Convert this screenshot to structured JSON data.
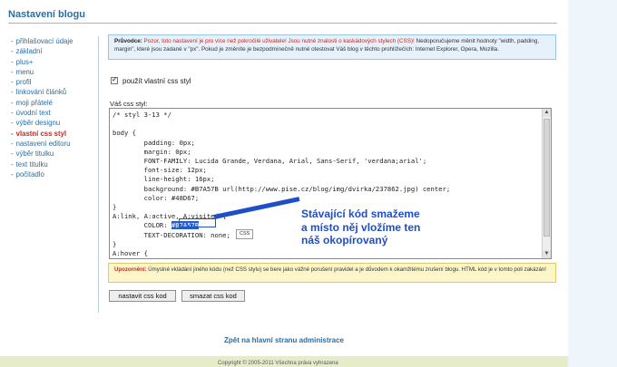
{
  "page": {
    "title": "Nastavení blogu"
  },
  "sidebar": {
    "items": [
      {
        "label": "přihlašovací údaje",
        "active": false
      },
      {
        "label": "základní",
        "active": false
      },
      {
        "label": "plus+",
        "active": false
      },
      {
        "label": "menu",
        "active": false
      },
      {
        "label": "profil",
        "active": false
      },
      {
        "label": "linkování článků",
        "active": false
      },
      {
        "label": "moji přátelé",
        "active": false
      },
      {
        "label": "úvodní text",
        "active": false
      },
      {
        "label": "výběr designu",
        "active": false
      },
      {
        "label": "vlastní css styl",
        "active": true
      },
      {
        "label": "nastavení editoru",
        "active": false
      },
      {
        "label": "výběr titulku",
        "active": false
      },
      {
        "label": "text titulku",
        "active": false
      },
      {
        "label": "počitadlo",
        "active": false
      }
    ]
  },
  "guide_notice": {
    "lead": "Průvodce:",
    "warning": "Pozor, toto nastavení je pro více než pokročilé uživatele! Jsou nutné znalosti o kaskádových stylech (CSS)!",
    "body": "Nedoporučujeme měnit hodnoty \"width, padding, margin\", které jsou zadané v \"px\". Pokud je změníte je bezpodmínečně nutné otestovat Váš blog v těchto prohlížečích: Internet Explorer, Opera, Mozilla."
  },
  "use_custom_css": {
    "checked": true,
    "label": "použít vlastní css styl"
  },
  "css_editor": {
    "label": "Váš css styl:",
    "code_before": "/* styl 3-13 */\n\nbody {\n        padding: 0px;\n        margin: 0px;\n        FONT-FAMILY: Lucida Grande, Verdana, Arial, Sans-Serif, 'verdana;arial';\n        font-size: 12px;\n        line-height: 16px;\n        background: #B7A57B url(http://www.pise.cz/blog/img/dvirka/237862.jpg) center;\n        color: #48D67;\n}\nA:link, A:active, A:visited {\n        COLOR: ",
    "code_highlight": "#B7A57B",
    "code_after": "\n        TEXT-DECORATION: none;\n}\nA:hover {",
    "tooltip": "CSS"
  },
  "annotation": {
    "text": "Stávající kód smažeme\na místo něj vložíme ten\nnáš okopírovaný",
    "color": "#1f4fc8"
  },
  "warning_notice": {
    "lead": "Upozornění:",
    "body": "Úmyslné vkládání jiného kódu (než CSS stylu) se bere jako vážné porušení pravidel a je důvodem k okamžitému zrušení blogu. HTML kód je v tomto poli zakázán!"
  },
  "buttons": {
    "save": "nastavit css kod",
    "delete": "smazat css kod"
  },
  "footer": {
    "back_link": "Zpět na hlavní stranu administrace",
    "copyright": "Copyright © 2005-2011 Všechna práva vyhrazena"
  },
  "colors": {
    "accent": "#2a6ea3",
    "active": "#c8281e",
    "background": "#eaf3fb"
  }
}
